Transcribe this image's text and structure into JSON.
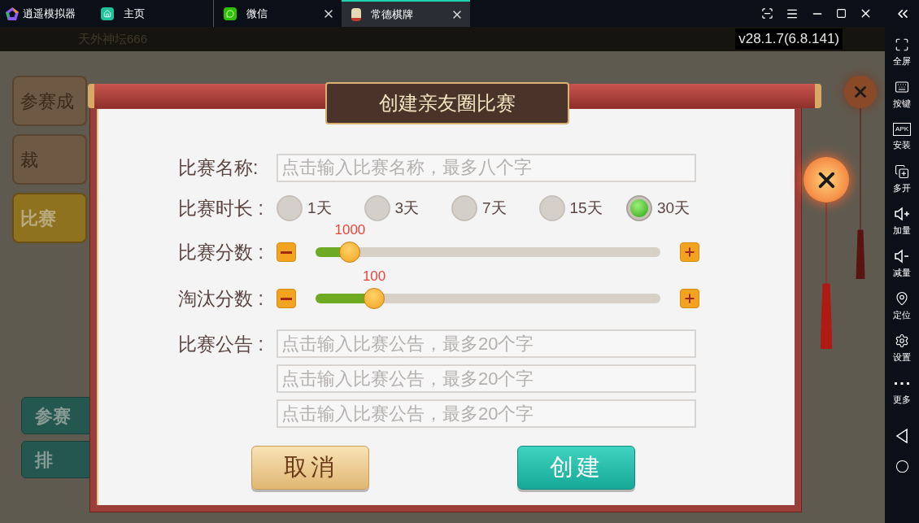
{
  "emulator": {
    "app_name": "逍遥模拟器",
    "version": "v28.1.7(6.8.141)",
    "tabs": [
      {
        "label": "主页",
        "kind": "home",
        "selected": false,
        "closable": false
      },
      {
        "label": "微信",
        "kind": "chat",
        "selected": false,
        "closable": true
      },
      {
        "label": "常德棋牌",
        "kind": "game",
        "selected": true,
        "closable": true
      }
    ]
  },
  "sidebar": [
    {
      "label": "全屏",
      "kind": "fullscreen"
    },
    {
      "label": "按键",
      "kind": "keyboard"
    },
    {
      "label": "安装",
      "kind": "apk",
      "icon_text": "APK"
    },
    {
      "label": "多开",
      "kind": "multi"
    },
    {
      "label": "加量",
      "kind": "volume_up"
    },
    {
      "label": "减量",
      "kind": "volume_down"
    },
    {
      "label": "定位",
      "kind": "location"
    },
    {
      "label": "设置",
      "kind": "settings"
    },
    {
      "label": "更多",
      "kind": "more"
    }
  ],
  "background": {
    "player_name": "天外神坛666",
    "side_buttons": [
      {
        "label": "参赛成",
        "selected": false
      },
      {
        "label": "裁",
        "selected": false
      },
      {
        "label": "比赛",
        "selected": true
      }
    ],
    "bottom_buttons": [
      "参赛",
      "排"
    ]
  },
  "dialog": {
    "title": "创建亲友圈比赛",
    "name": {
      "label": "比赛名称:",
      "placeholder": "点击输入比赛名称，最多八个字"
    },
    "duration": {
      "label": "比赛时长 :",
      "options": [
        {
          "label": "1天",
          "selected": false
        },
        {
          "label": "3天",
          "selected": false
        },
        {
          "label": "7天",
          "selected": false
        },
        {
          "label": "15天",
          "selected": false
        },
        {
          "label": "30天",
          "selected": true
        }
      ]
    },
    "sliders": [
      {
        "label": "比赛分数 :",
        "value": "1000",
        "level": 0.1
      },
      {
        "label": "淘汰分数 :",
        "value": "100",
        "level": 0.17
      }
    ],
    "notice": {
      "label": "比赛公告 :",
      "fields": [
        {
          "placeholder": "点击输入比赛公告，最多20个字"
        },
        {
          "placeholder": "点击输入比赛公告，最多20个字"
        },
        {
          "placeholder": "点击输入比赛公告，最多20个字"
        }
      ]
    },
    "buttons": [
      {
        "label": "取消",
        "kind": "cancel"
      },
      {
        "label": "创建",
        "kind": "create"
      }
    ]
  }
}
